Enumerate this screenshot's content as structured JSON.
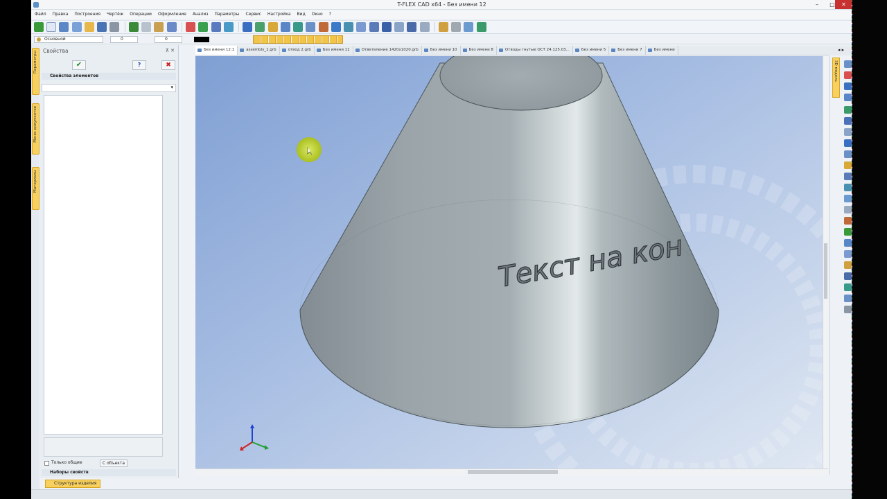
{
  "window": {
    "title": "T-FLEX CAD x64 - Без имени 12",
    "minimize": "–",
    "maximize": "□",
    "close": "✕"
  },
  "menu": [
    "Файл",
    "Правка",
    "Построения",
    "Чертёж",
    "Операции",
    "Оформление",
    "Анализ",
    "Параметры",
    "Сервис",
    "Настройка",
    "Вид",
    "Окно",
    "?"
  ],
  "toolbar2": {
    "layer": "Основной",
    "value1": "0",
    "value2": "0"
  },
  "panel": {
    "title": "Свойства",
    "pin": "⊼ ✕",
    "ok_glyph": "✔",
    "help_glyph": "?",
    "cancel_glyph": "✖",
    "section_props": "Свойства элементов",
    "combo_arrow": "▾",
    "only_common": "Только общие",
    "from_object": "С объекта",
    "section_sets": "Наборы свойств"
  },
  "left_tabs": [
    "Параметры",
    "Меню документов",
    "Материалы"
  ],
  "bottom_tab": "Структура изделия",
  "doc_tabs": [
    "Без имени 12:1",
    "assembly_1.grb",
    "отвод 2.grb",
    "Без имени 11",
    "Ответвление 1420х1020.grb",
    "Без имени 10",
    "Без имени 8",
    "Отводы гнутые ОСТ 24.125.03...",
    "Без имени 5",
    "Без имени 7",
    "Без имени"
  ],
  "tab_scroll": "◂ ▸",
  "right_panel_tab": "3D модель",
  "model": {
    "engraved_text": "Текст на конусе",
    "visible_text": "Текст на кон"
  },
  "colors": {
    "accent": "#f7d060",
    "close": "#c7312f",
    "background_top": "#9fb6df",
    "cone_mid": "#9ba6ac"
  }
}
